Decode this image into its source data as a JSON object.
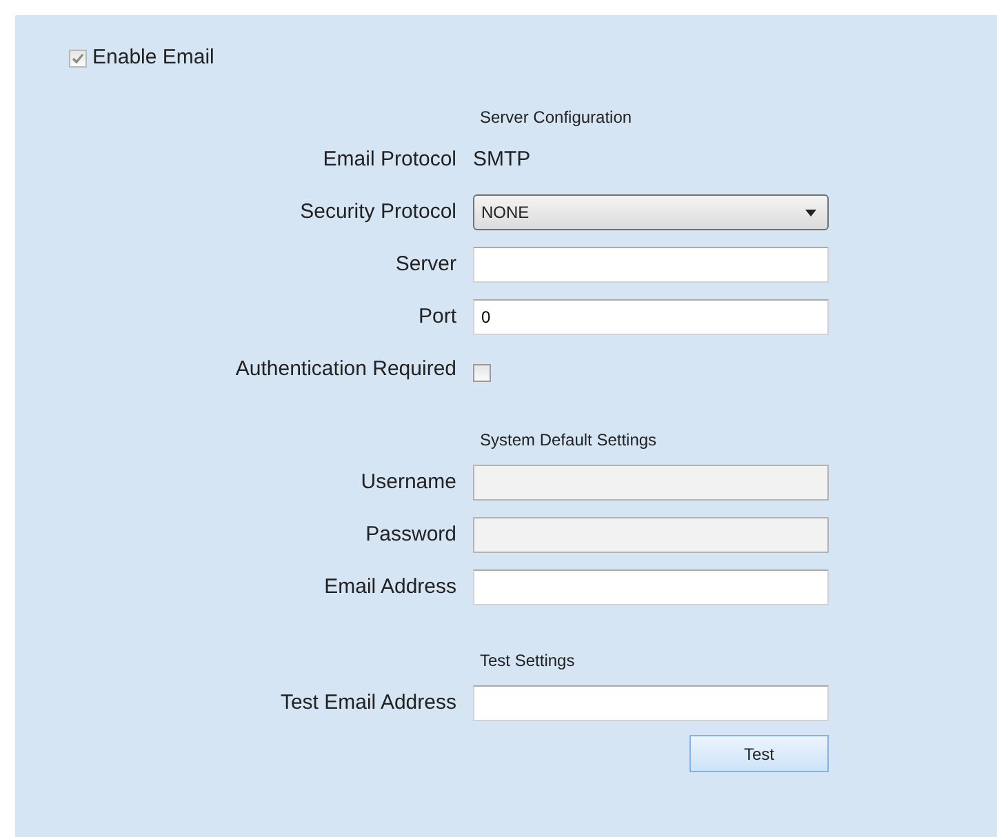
{
  "enable_email": {
    "label": "Enable Email",
    "checked": true
  },
  "sections": [
    {
      "heading": "Server Configuration",
      "rows": [
        {
          "kind": "text",
          "label": "Email Protocol",
          "value": "SMTP"
        },
        {
          "kind": "select",
          "label": "Security Protocol",
          "value": "NONE"
        },
        {
          "kind": "input",
          "label": "Server",
          "disabled": false
        },
        {
          "kind": "input",
          "label": "Port",
          "value": "0",
          "disabled": false
        },
        {
          "kind": "checkbox",
          "label": "Authentication Required",
          "checked": false
        }
      ]
    },
    {
      "heading": "System Default Settings",
      "rows": [
        {
          "kind": "input",
          "label": "Username",
          "disabled": true
        },
        {
          "kind": "input",
          "label": "Password",
          "disabled": true
        },
        {
          "kind": "input",
          "label": "Email Address",
          "disabled": false
        }
      ]
    },
    {
      "heading": "Test Settings",
      "rows": [
        {
          "kind": "input",
          "label": "Test Email Address",
          "disabled": false
        }
      ]
    }
  ],
  "test_button": "Test"
}
